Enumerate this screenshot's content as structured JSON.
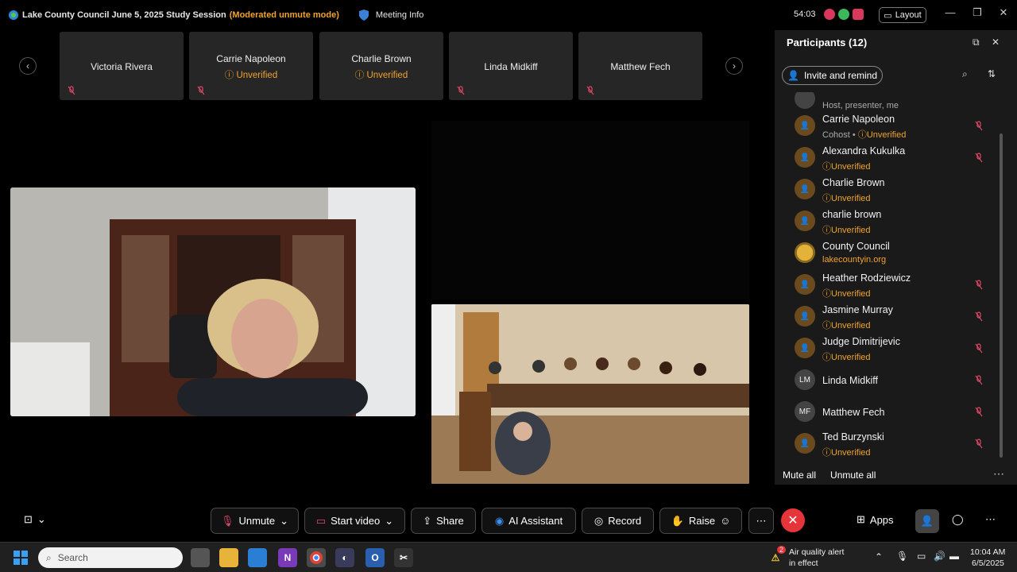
{
  "titlebar": {
    "meeting_title": "Lake County Council June 5, 2025 Study Session",
    "mode": "(Moderated unmute mode)",
    "meeting_info": "Meeting Info",
    "timer": "54:03",
    "layout": "Layout"
  },
  "thumbnails": [
    {
      "name": "Victoria Rivera",
      "status": ""
    },
    {
      "name": "Carrie Napoleon",
      "status": "Unverified"
    },
    {
      "name": "Charlie Brown",
      "status": "Unverified"
    },
    {
      "name": "Linda Midkiff",
      "status": ""
    },
    {
      "name": "Matthew Fech",
      "status": ""
    }
  ],
  "panel": {
    "title": "Participants (12)",
    "invite": "Invite and remind",
    "mute_all": "Mute all",
    "unmute_all": "Unmute all",
    "participants": [
      {
        "name": "",
        "sub": "Host, presenter, me",
        "sub_style": "gray",
        "avatar": "orange",
        "initials": "",
        "muted": false
      },
      {
        "name": "Carrie Napoleon",
        "sub": "Cohost • Unverified",
        "sub_style": "orange",
        "avatar": "orange",
        "initials": "",
        "muted": true
      },
      {
        "name": "Alexandra Kukulka",
        "sub": "Unverified",
        "sub_style": "orange",
        "avatar": "orange",
        "initials": "",
        "muted": true
      },
      {
        "name": "Charlie Brown",
        "sub": "Unverified",
        "sub_style": "orange",
        "avatar": "orange",
        "initials": "",
        "muted": false
      },
      {
        "name": "charlie brown",
        "sub": "Unverified",
        "sub_style": "orange",
        "avatar": "orange",
        "initials": "",
        "muted": false
      },
      {
        "name": "County Council",
        "sub": "lakecountyin.org",
        "sub_style": "orange",
        "avatar": "gold",
        "initials": "",
        "muted": false
      },
      {
        "name": "Heather Rodziewicz",
        "sub": "Unverified",
        "sub_style": "orange",
        "avatar": "orange",
        "initials": "",
        "muted": true
      },
      {
        "name": "Jasmine Murray",
        "sub": "Unverified",
        "sub_style": "orange",
        "avatar": "orange",
        "initials": "",
        "muted": true
      },
      {
        "name": "Judge Dimitrijevic",
        "sub": "Unverified",
        "sub_style": "orange",
        "avatar": "orange",
        "initials": "",
        "muted": true
      },
      {
        "name": "Linda Midkiff",
        "sub": "",
        "sub_style": "orange",
        "avatar": "gray",
        "initials": "LM",
        "muted": true
      },
      {
        "name": "Matthew Fech",
        "sub": "",
        "sub_style": "orange",
        "avatar": "gray",
        "initials": "MF",
        "muted": true
      },
      {
        "name": "Ted Burzynski",
        "sub": "Unverified",
        "sub_style": "orange",
        "avatar": "orange",
        "initials": "",
        "muted": true
      }
    ]
  },
  "toolbar": {
    "unmute": "Unmute",
    "start_video": "Start video",
    "share": "Share",
    "ai_assistant": "AI Assistant",
    "record": "Record",
    "raise": "Raise",
    "apps": "Apps"
  },
  "taskbar": {
    "search": "Search",
    "alert_badge": "2",
    "alert_title": "Air quality alert",
    "alert_sub": "in effect",
    "time": "10:04 AM",
    "date": "6/5/2025"
  },
  "colors": {
    "accent_orange": "#f0a32e",
    "end_red": "#e5343a",
    "panel_bg": "#1a1a1a"
  }
}
